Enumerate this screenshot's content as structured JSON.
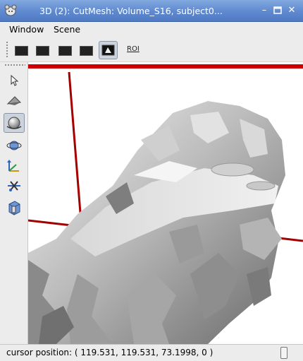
{
  "window": {
    "title": "3D (2): CutMesh: Volume_S16, subject0...",
    "app_icon": "mouse-head-icon",
    "controls": [
      "minimize-icon",
      "maximize-icon",
      "close-icon"
    ]
  },
  "menubar": {
    "items": [
      "Window",
      "Scene"
    ]
  },
  "toolbar": {
    "view_buttons": [
      "axial-view-icon",
      "coronal-view-icon",
      "sagittal-view-icon",
      "oblique-view-icon",
      "3d-view-icon"
    ],
    "active_view": "3d-view-icon",
    "roi_label": "ROI"
  },
  "sidebar": {
    "tools": [
      "select-arrow-icon",
      "fly-plane-icon",
      "rotate-sphere-icon",
      "orbit-icon",
      "translate-axes-icon",
      "zoom-cut-icon",
      "clip-box-icon"
    ],
    "active_tool": "rotate-sphere-icon"
  },
  "viewport": {
    "background": "#ffffff",
    "axis_color": "#b00000",
    "mesh_color": "#a8a8a8"
  },
  "status": {
    "text": "cursor position: ( 119.531, 119.531, 73.1998, 0 )"
  }
}
